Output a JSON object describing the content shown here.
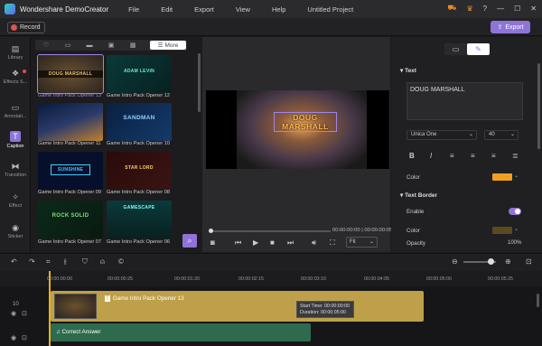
{
  "app": {
    "name": "Wondershare DemoCreator",
    "project": "Untitled Project",
    "menu": [
      "File",
      "Edit",
      "Export",
      "View",
      "Help"
    ]
  },
  "toolbar": {
    "record": "Record",
    "export": "Export"
  },
  "sidebar": [
    {
      "label": "Library",
      "icon": "folder-icon"
    },
    {
      "label": "Effects S...",
      "icon": "effects-icon"
    },
    {
      "label": "Annotati...",
      "icon": "annotation-icon"
    },
    {
      "label": "Caption",
      "icon": "caption-icon",
      "active": true
    },
    {
      "label": "Transition",
      "icon": "transition-icon"
    },
    {
      "label": "Effect",
      "icon": "effect-icon"
    },
    {
      "label": "Sticker",
      "icon": "sticker-icon"
    }
  ],
  "media": {
    "more": "More",
    "items": [
      {
        "name": "Game Intro Pack Opener 13",
        "title": "DOUG MARSHALL",
        "selected": true
      },
      {
        "name": "Game Intro Pack Opener 12",
        "title": "ADAM LEVIN"
      },
      {
        "name": "Game Intro Pack Opener 11",
        "title": ""
      },
      {
        "name": "Game Intro Pack Opener 10",
        "title": "SANDMAN"
      },
      {
        "name": "Game Intro Pack Opener 09",
        "title": "SUNSHINE"
      },
      {
        "name": "Game Intro Pack Opener 08",
        "title": "STAR LORD"
      },
      {
        "name": "Game Intro Pack Opener 07",
        "title": "ROCK SOLID"
      },
      {
        "name": "Game Intro Pack Opener 06",
        "title": "GAMESCAPE"
      }
    ]
  },
  "preview": {
    "title": "DOUG MARSHALL",
    "time": "00:00:00:00 | 00:00:00:05",
    "fit": "Fit",
    "progress": 0
  },
  "props": {
    "text_section": "Text",
    "text_value": "DOUG MARSHALL",
    "font": "Unica One",
    "size": "40",
    "color_label": "Color",
    "color": "#f0a020",
    "border_section": "Text Border",
    "enable_label": "Enable",
    "border_color_label": "Color",
    "border_color": "#5a4a20",
    "opacity_label": "Opacity",
    "opacity": "100%"
  },
  "timeline": {
    "ticks": [
      "00:00:00:00",
      "00:00:00:25",
      "00:00:01:20",
      "00:00:02:15",
      "00:00:03:10",
      "00:00:04:05",
      "00:00:05:00",
      "00:00:05:25"
    ],
    "track1": {
      "label": "Game Intro Pack Opener 13",
      "tooltip_start": "Start Time: 00:00:00:00",
      "tooltip_dur": "Duration: 00:00:05:00"
    },
    "track2": {
      "label": "Correct Answer"
    },
    "track_num": "10"
  }
}
